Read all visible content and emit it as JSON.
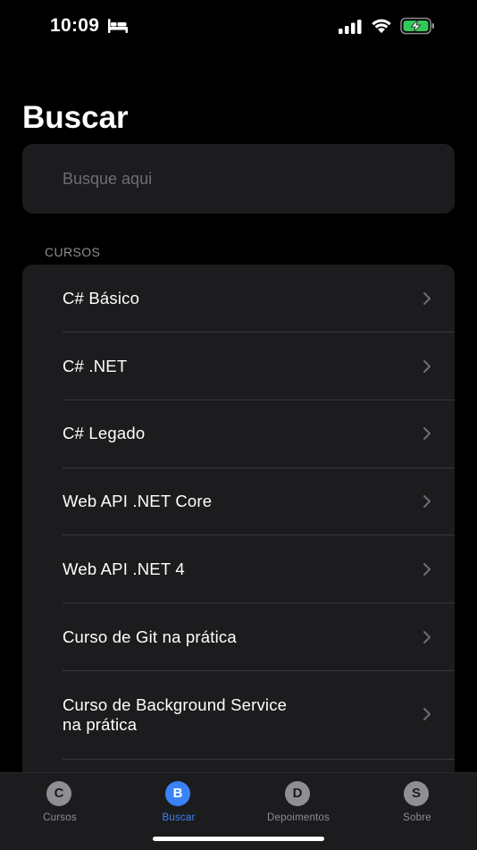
{
  "status_bar": {
    "time": "10:09",
    "icons": [
      "bed-icon",
      "cellular-signal-icon",
      "wifi-icon",
      "battery-charging-icon"
    ]
  },
  "page": {
    "title": "Buscar"
  },
  "search": {
    "placeholder": "Busque aqui",
    "value": ""
  },
  "section": {
    "header": "CURSOS"
  },
  "courses": [
    {
      "label": "C# Básico"
    },
    {
      "label": "C# .NET"
    },
    {
      "label": "C# Legado"
    },
    {
      "label": "Web API .NET Core"
    },
    {
      "label": "Web API .NET 4"
    },
    {
      "label": "Curso de Git na prática"
    },
    {
      "label_line1": "Curso de Background Service",
      "label_line2": "na prática"
    }
  ],
  "tab_bar": {
    "tabs": [
      {
        "letter": "C",
        "label": "Cursos",
        "active": false
      },
      {
        "letter": "B",
        "label": "Buscar",
        "active": true
      },
      {
        "letter": "D",
        "label": "Depoimentos",
        "active": false
      },
      {
        "letter": "S",
        "label": "Sobre",
        "active": false
      }
    ]
  },
  "colors": {
    "background": "#000000",
    "surface": "#1c1c1e",
    "accent": "#3a82f7",
    "secondary_text": "#8e8e93",
    "battery_green": "#34c759"
  }
}
